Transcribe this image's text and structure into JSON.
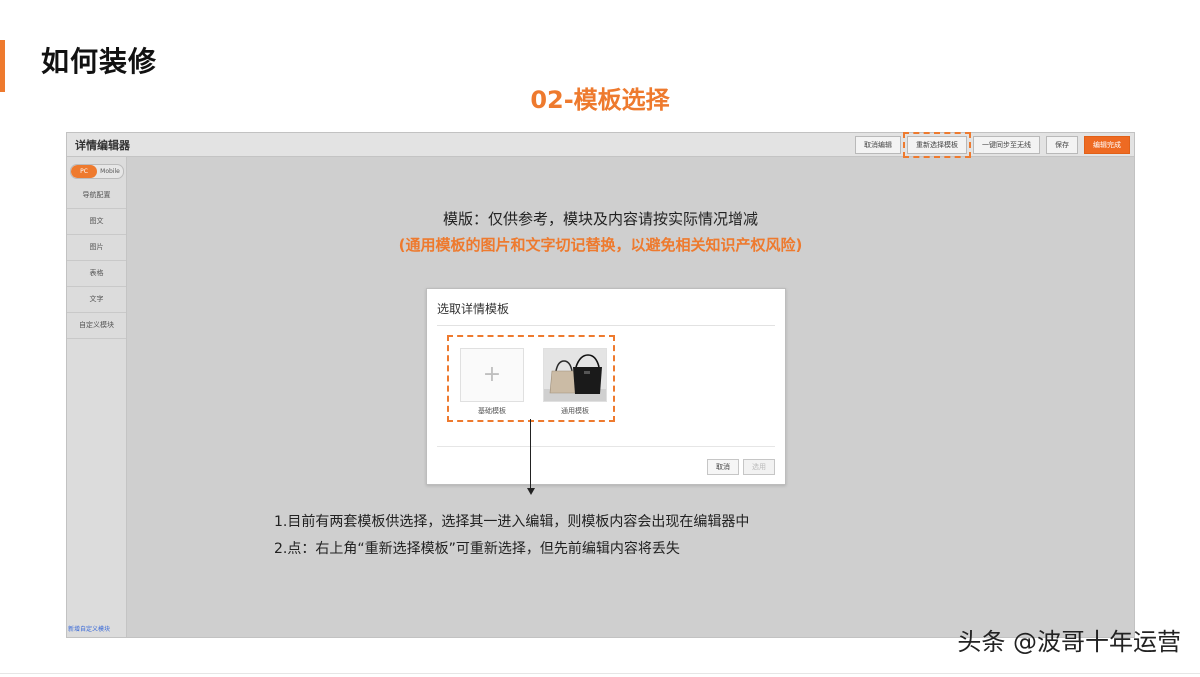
{
  "slide": {
    "title": "如何装修",
    "section_title": "02-模板选择"
  },
  "editor": {
    "title": "详情编辑器",
    "actions": [
      "取消编辑",
      "重新选择模板",
      "一键同步至无线",
      "保存",
      "编辑完成"
    ],
    "device_toggle": [
      "PC",
      "Mobile"
    ],
    "sidebar_items": [
      "导航配置",
      "图文",
      "图片",
      "表格",
      "文字",
      "自定义模块"
    ],
    "sidebar_bottom": "新增自定义模块",
    "note_main": "模版：仅供参考，模块及内容请按实际情况增减",
    "note_warn": "(通用模板的图片和文字切记替换，以避免相关知识产权风险)"
  },
  "dialog": {
    "title": "选取详情模板",
    "templates": [
      {
        "label": "基础模板",
        "icon": "plus-icon"
      },
      {
        "label": "通用模板",
        "icon": "handbag-photo"
      }
    ],
    "cancel_label": "取消",
    "select_label": "选用"
  },
  "notes": [
    "1.目前有两套模板供选择，选择其一进入编辑，则模板内容会出现在编辑器中",
    "2.点：右上角“重新选择模板”可重新选择，但先前编辑内容将丢失"
  ],
  "watermark": "头条 @波哥十年运营",
  "colors": {
    "accent": "#ee7a2e",
    "done_button": "#ee6a22",
    "editor_bg": "#cfcfcf"
  }
}
